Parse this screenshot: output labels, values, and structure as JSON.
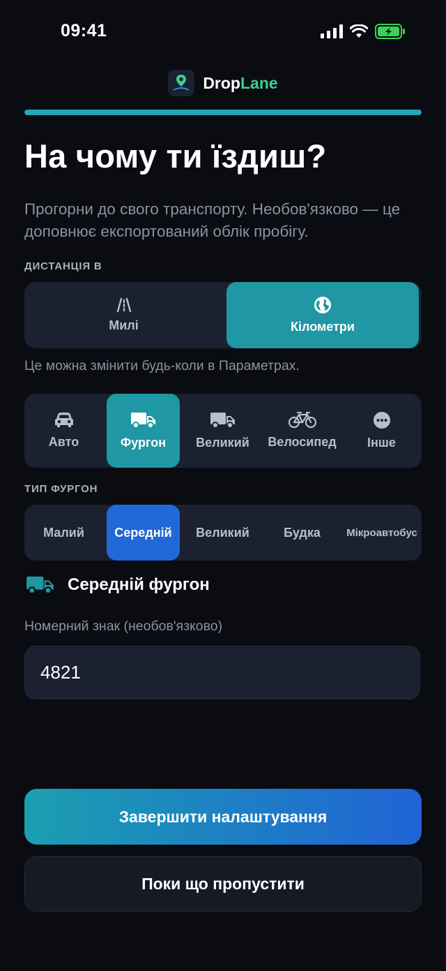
{
  "status_bar": {
    "time": "09:41"
  },
  "brand": {
    "name_part1": "Drop",
    "name_part2": "Lane",
    "accent": "#3ecf8e"
  },
  "progress": {
    "fraction": 1.0,
    "color": "#23a7b5"
  },
  "header": {
    "title": "На чому ти їздиш?",
    "subtitle": "Прогорни до свого транспорту. Необов'язково — це доповнює експортований облік пробігу."
  },
  "units": {
    "label": "ДИСТАНЦІЯ В",
    "options": [
      {
        "label": "Милі",
        "icon": "road-icon",
        "selected": false
      },
      {
        "label": "Кілометри",
        "icon": "globe-icon",
        "selected": true
      }
    ],
    "hint": "Це можна змінити будь-коли в Параметрах."
  },
  "vehicles": {
    "options": [
      {
        "label": "Авто",
        "icon": "car-icon",
        "selected": false
      },
      {
        "label": "Фургон",
        "icon": "van-icon",
        "selected": true
      },
      {
        "label": "Великий",
        "icon": "truck-icon",
        "selected": false
      },
      {
        "label": "Велосипед",
        "icon": "bicycle-icon",
        "selected": false
      },
      {
        "label": "Інше",
        "icon": "more-icon",
        "selected": false
      }
    ]
  },
  "van_type": {
    "label": "ТИП ФУРГОН",
    "options": [
      {
        "label": "Малий",
        "selected": false
      },
      {
        "label": "Середній",
        "selected": true
      },
      {
        "label": "Великий",
        "selected": false
      },
      {
        "label": "Будка",
        "selected": false
      },
      {
        "label": "Мікроавтобус",
        "selected": false
      }
    ]
  },
  "selected_vehicle": {
    "label": "Середній фургон",
    "icon": "van-icon",
    "color": "#1f97a4"
  },
  "plate": {
    "label": "Номерний знак (необов'язково)",
    "value": "4821"
  },
  "actions": {
    "primary": "Завершити налаштування",
    "secondary": "Поки що пропустити"
  },
  "colors": {
    "background": "#0a0c11",
    "surface": "#1b2130",
    "teal": "#1f97a4",
    "blue": "#2168d8"
  }
}
